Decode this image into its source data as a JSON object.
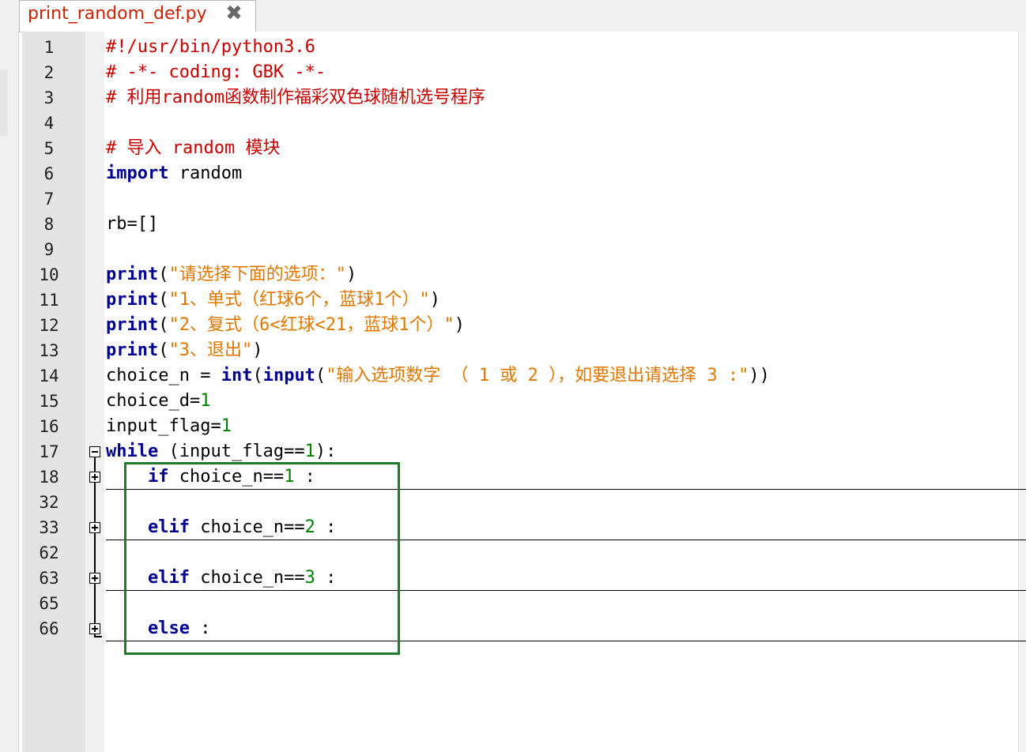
{
  "tab": {
    "title": "print_random_def.py",
    "close_icon": "close-icon"
  },
  "colors": {
    "comment": "#c80000",
    "keyword": "#000090",
    "string": "#e07800",
    "number": "#008000",
    "highlight_box": "#1f7a2e"
  },
  "lines": [
    {
      "num": "1",
      "parts": [
        {
          "t": "#!/usr/bin/python3.6",
          "c": "cm"
        }
      ]
    },
    {
      "num": "2",
      "parts": [
        {
          "t": "# -*- coding: GBK -*-",
          "c": "cm"
        }
      ]
    },
    {
      "num": "3",
      "parts": [
        {
          "t": "# 利用random函数制作福彩双色球随机选号程序",
          "c": "cm"
        }
      ]
    },
    {
      "num": "4",
      "parts": []
    },
    {
      "num": "5",
      "parts": [
        {
          "t": "# 导入 random 模块",
          "c": "cm"
        }
      ]
    },
    {
      "num": "6",
      "parts": [
        {
          "t": "import",
          "c": "kw"
        },
        {
          "t": " random",
          "c": "ph"
        }
      ]
    },
    {
      "num": "7",
      "parts": []
    },
    {
      "num": "8",
      "parts": [
        {
          "t": "rb=[]",
          "c": "ph"
        }
      ]
    },
    {
      "num": "9",
      "parts": []
    },
    {
      "num": "10",
      "parts": [
        {
          "t": "print",
          "c": "kw"
        },
        {
          "t": "(",
          "c": "ph"
        },
        {
          "t": "\"请选择下面的选项：\"",
          "c": "st"
        },
        {
          "t": ")",
          "c": "ph"
        }
      ]
    },
    {
      "num": "11",
      "parts": [
        {
          "t": "print",
          "c": "kw"
        },
        {
          "t": "(",
          "c": "ph"
        },
        {
          "t": "\"1、单式（红球6个，蓝球1个）\"",
          "c": "st"
        },
        {
          "t": ")",
          "c": "ph"
        }
      ]
    },
    {
      "num": "12",
      "parts": [
        {
          "t": "print",
          "c": "kw"
        },
        {
          "t": "(",
          "c": "ph"
        },
        {
          "t": "\"2、复式（6<红球<21，蓝球1个）\"",
          "c": "st"
        },
        {
          "t": ")",
          "c": "ph"
        }
      ]
    },
    {
      "num": "13",
      "parts": [
        {
          "t": "print",
          "c": "kw"
        },
        {
          "t": "(",
          "c": "ph"
        },
        {
          "t": "\"3、退出\"",
          "c": "st"
        },
        {
          "t": ")",
          "c": "ph"
        }
      ]
    },
    {
      "num": "14",
      "parts": [
        {
          "t": "choice_n = ",
          "c": "ph"
        },
        {
          "t": "int",
          "c": "kw"
        },
        {
          "t": "(",
          "c": "ph"
        },
        {
          "t": "input",
          "c": "kw"
        },
        {
          "t": "(",
          "c": "ph"
        },
        {
          "t": "\"输入选项数字 （ 1 或 2 ），如要退出请选择 3 :\"",
          "c": "st"
        },
        {
          "t": "))",
          "c": "ph"
        }
      ]
    },
    {
      "num": "15",
      "parts": [
        {
          "t": "choice_d=",
          "c": "ph"
        },
        {
          "t": "1",
          "c": "nm"
        }
      ]
    },
    {
      "num": "16",
      "parts": [
        {
          "t": "input_flag=",
          "c": "ph"
        },
        {
          "t": "1",
          "c": "nm"
        }
      ]
    },
    {
      "num": "17",
      "parts": [
        {
          "t": "while",
          "c": "kw"
        },
        {
          "t": " (input_flag==",
          "c": "ph"
        },
        {
          "t": "1",
          "c": "nm"
        },
        {
          "t": "):",
          "c": "ph"
        }
      ]
    },
    {
      "num": "18",
      "parts": [
        {
          "t": "    ",
          "c": "ph"
        },
        {
          "t": "if",
          "c": "kw"
        },
        {
          "t": " choice_n==",
          "c": "ph"
        },
        {
          "t": "1",
          "c": "nm"
        },
        {
          "t": " :",
          "c": "ph"
        }
      ]
    },
    {
      "num": "32",
      "parts": []
    },
    {
      "num": "33",
      "parts": [
        {
          "t": "    ",
          "c": "ph"
        },
        {
          "t": "elif",
          "c": "kw"
        },
        {
          "t": " choice_n==",
          "c": "ph"
        },
        {
          "t": "2",
          "c": "nm"
        },
        {
          "t": " :",
          "c": "ph"
        }
      ]
    },
    {
      "num": "62",
      "parts": []
    },
    {
      "num": "63",
      "parts": [
        {
          "t": "    ",
          "c": "ph"
        },
        {
          "t": "elif",
          "c": "kw"
        },
        {
          "t": " choice_n==",
          "c": "ph"
        },
        {
          "t": "3",
          "c": "nm"
        },
        {
          "t": " :",
          "c": "ph"
        }
      ]
    },
    {
      "num": "65",
      "parts": []
    },
    {
      "num": "66",
      "parts": [
        {
          "t": "    ",
          "c": "ph"
        },
        {
          "t": "else",
          "c": "kw"
        },
        {
          "t": " :",
          "c": "ph"
        }
      ]
    }
  ]
}
